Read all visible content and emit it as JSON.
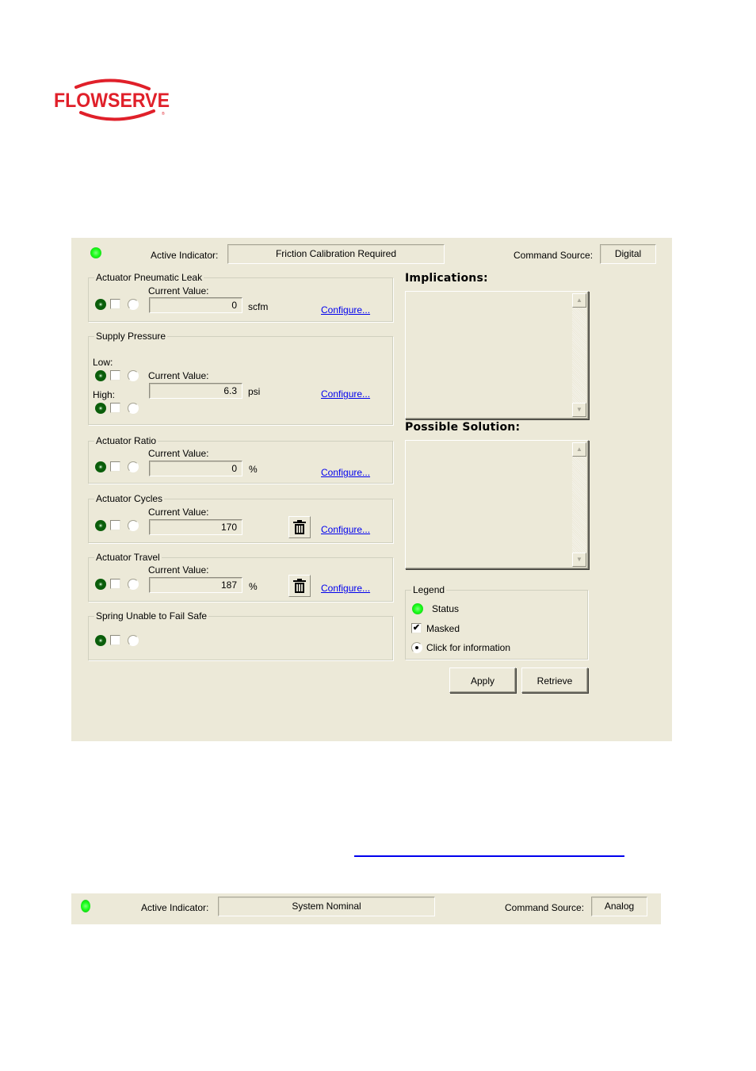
{
  "logo": {
    "text": "FLOWSERVE",
    "color": "#e0202a"
  },
  "panel": {
    "status_led_color": "#1aff1a",
    "active_indicator_label": "Active Indicator:",
    "active_indicator_value": "Friction Calibration Required",
    "command_source_label": "Command Source:",
    "command_source_value": "Digital",
    "current_value_label": "Current Value:",
    "configure_label": "Configure...",
    "groups": [
      {
        "title": "Actuator Pneumatic Leak",
        "value": "0",
        "unit": "scfm",
        "has_trash": false
      },
      {
        "title": "Supply Pressure",
        "low_label": "Low:",
        "high_label": "High:",
        "value": "6.3",
        "unit": "psi",
        "has_trash": false
      },
      {
        "title": "Actuator Ratio",
        "value": "0",
        "unit": "%",
        "has_trash": false
      },
      {
        "title": "Actuator Cycles",
        "value": "170",
        "unit": "",
        "has_trash": true
      },
      {
        "title": "Actuator Travel",
        "value": "187",
        "unit": "%",
        "has_trash": true
      },
      {
        "title": "Spring Unable to Fail Safe"
      }
    ],
    "implications_label": "Implications:",
    "implications_text": "",
    "possible_solution_label": "Possible Solution:",
    "possible_solution_text": "",
    "legend": {
      "title": "Legend",
      "status": "Status",
      "masked": "Masked",
      "click_info": "Click for information"
    },
    "buttons": {
      "apply": "Apply",
      "retrieve": "Retrieve"
    }
  },
  "status_bar": {
    "active_indicator_label": "Active Indicator:",
    "active_indicator_value": "System Nominal",
    "command_source_label": "Command Source:",
    "command_source_value": "Analog"
  }
}
